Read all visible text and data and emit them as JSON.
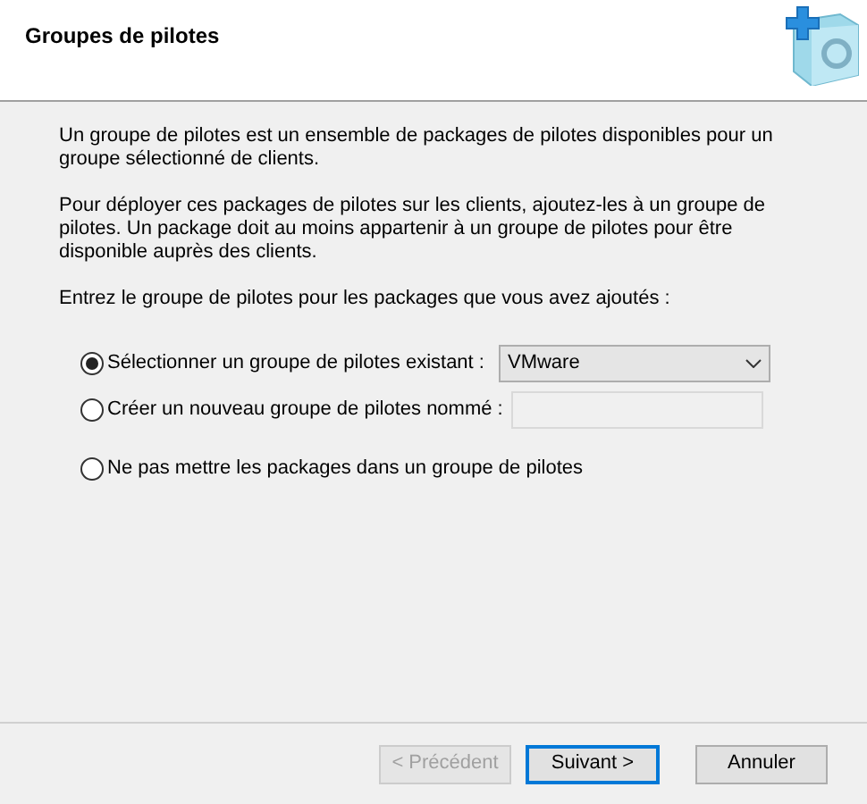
{
  "header": {
    "title": "Groupes de pilotes"
  },
  "paragraphs": [
    "Un groupe de pilotes est un ensemble de packages de pilotes disponibles pour un groupe sélectionné de clients.",
    "Pour déployer ces packages de pilotes sur les clients, ajoutez-les à un groupe de pilotes. Un package doit au moins appartenir à un groupe de pilotes pour être disponible auprès des clients.",
    "Entrez le groupe de pilotes pour les packages que vous avez ajoutés :"
  ],
  "options": [
    {
      "label": "Sélectionner un groupe de pilotes existant :",
      "selected": true,
      "kind": "dropdown",
      "value": "VMware"
    },
    {
      "label": "Créer un nouveau groupe de pilotes nommé :",
      "selected": false,
      "kind": "text"
    },
    {
      "label": "Ne pas mettre les packages dans un groupe de pilotes",
      "selected": false,
      "kind": "plain"
    }
  ],
  "buttons": [
    {
      "label": "< Précédent",
      "disabled": true,
      "default": false
    },
    {
      "label": "Suivant >",
      "disabled": false,
      "default": true
    },
    {
      "label": "Annuler",
      "disabled": false,
      "default": false
    }
  ]
}
